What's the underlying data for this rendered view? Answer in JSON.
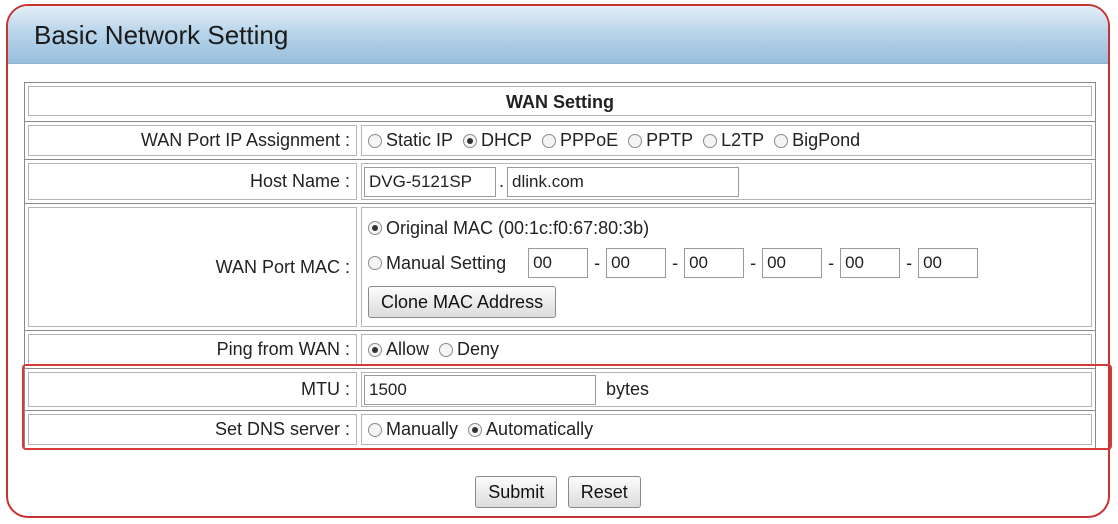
{
  "title": "Basic Network Setting",
  "section_header": "WAN Setting",
  "wan_ip": {
    "label": "WAN Port IP Assignment :",
    "options": [
      "Static IP",
      "DHCP",
      "PPPoE",
      "PPTP",
      "L2TP",
      "BigPond"
    ],
    "selected": "DHCP"
  },
  "host": {
    "label": "Host Name :",
    "name_value": "DVG-5121SP",
    "separator": ".",
    "domain_value": "dlink.com"
  },
  "mac": {
    "label": "WAN Port MAC :",
    "original_label": "Original MAC (00:1c:f0:67:80:3b)",
    "manual_label": "Manual Setting",
    "octets": [
      "00",
      "00",
      "00",
      "00",
      "00",
      "00"
    ],
    "dash": "-",
    "selected": "Original",
    "clone_button": "Clone MAC Address"
  },
  "ping": {
    "label": "Ping from WAN :",
    "allow": "Allow",
    "deny": "Deny",
    "selected": "Allow"
  },
  "mtu": {
    "label": "MTU :",
    "value": "1500",
    "unit": "bytes"
  },
  "dns": {
    "label": "Set DNS server :",
    "manual": "Manually",
    "auto": "Automatically",
    "selected": "Automatically"
  },
  "buttons": {
    "submit": "Submit",
    "reset": "Reset"
  },
  "colors": {
    "highlight": "#d63a3a",
    "titlebar": "#98bedd"
  }
}
